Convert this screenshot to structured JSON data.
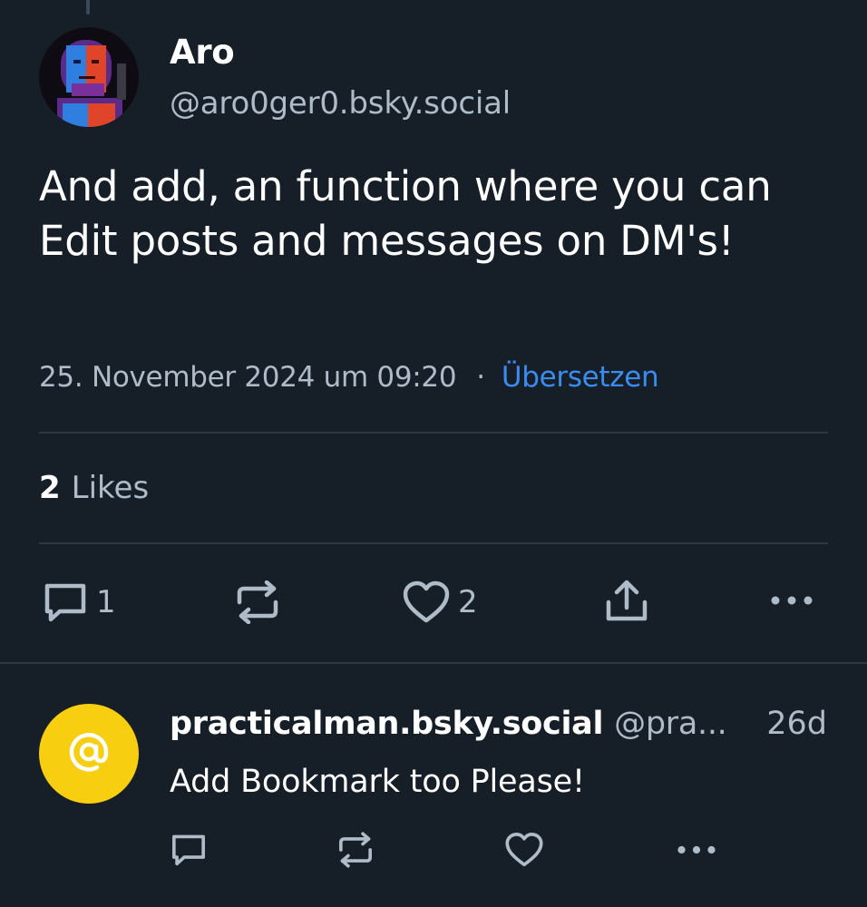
{
  "post": {
    "author_name": "Aro",
    "author_handle": "@aro0ger0.bsky.social",
    "text": "And add, an function where you can Edit posts and messages on DM's!",
    "timestamp": "25. November 2024 um 09:20",
    "separator": "·",
    "translate_label": "Übersetzen",
    "likes_count": "2",
    "likes_label": "Likes",
    "actions": {
      "reply_count": "1",
      "like_count": "2"
    }
  },
  "reply": {
    "avatar_icon": "at-sign-icon",
    "author_name": "practicalman.bsky.social",
    "author_handle": "@pra...",
    "time": "26d",
    "text": "Add Bookmark too Please!"
  },
  "colors": {
    "background": "#161e27",
    "text_muted": "#aebbc9",
    "link": "#3b8cf0",
    "reply_avatar": "#f7ce10"
  },
  "icons": {
    "reply": "speech-bubble-icon",
    "repost": "repost-arrows-icon",
    "like": "heart-icon",
    "share": "share-upload-icon",
    "more": "more-dots-icon"
  }
}
